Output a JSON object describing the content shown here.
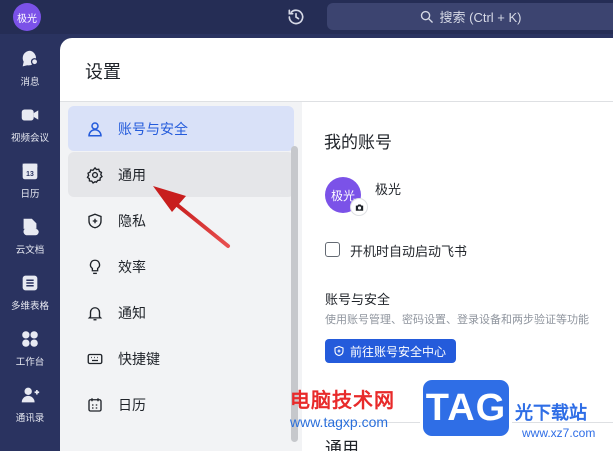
{
  "topbar": {
    "avatar_text": "极光",
    "search_label": "搜索 (Ctrl + K)"
  },
  "rail": {
    "items": [
      {
        "label": "消息",
        "icon": "chat-bubble-icon"
      },
      {
        "label": "视频会议",
        "icon": "video-camera-icon"
      },
      {
        "label": "日历",
        "icon": "calendar-icon"
      },
      {
        "label": "云文档",
        "icon": "cloud-doc-icon"
      },
      {
        "label": "多维表格",
        "icon": "table-icon"
      },
      {
        "label": "工作台",
        "icon": "workspace-icon"
      },
      {
        "label": "通讯录",
        "icon": "contacts-icon"
      }
    ]
  },
  "settings": {
    "title": "设置",
    "menu": [
      {
        "label": "账号与安全",
        "icon": "user-icon",
        "state": "active"
      },
      {
        "label": "通用",
        "icon": "gear-icon",
        "state": "hover"
      },
      {
        "label": "隐私",
        "icon": "shield-icon",
        "state": "normal"
      },
      {
        "label": "效率",
        "icon": "bulb-icon",
        "state": "normal"
      },
      {
        "label": "通知",
        "icon": "bell-icon",
        "state": "normal"
      },
      {
        "label": "快捷键",
        "icon": "keyboard-icon",
        "state": "normal"
      },
      {
        "label": "日历",
        "icon": "calendar-icon",
        "state": "normal"
      }
    ]
  },
  "content": {
    "account_heading": "我的账号",
    "avatar_text": "极光",
    "user_name": "极光",
    "auto_start_label": "开机时自动启动飞书",
    "auto_start_checked": false,
    "security_title": "账号与安全",
    "security_desc": "使用账号管理、密码设置、登录设备和两步验证等功能",
    "security_button": "前往账号安全中心",
    "general_heading": "通用"
  },
  "watermark": {
    "left_text": "电脑技术网",
    "left_url": "www.tagxp.com",
    "logo": "TAG",
    "right_text": "光下载站",
    "right_url": "www.xz7.com"
  },
  "colors": {
    "rail_bg": "#2a3360",
    "accent": "#245bdb",
    "avatar": "#7b52e8",
    "annotation_arrow": "#d42a2a"
  }
}
